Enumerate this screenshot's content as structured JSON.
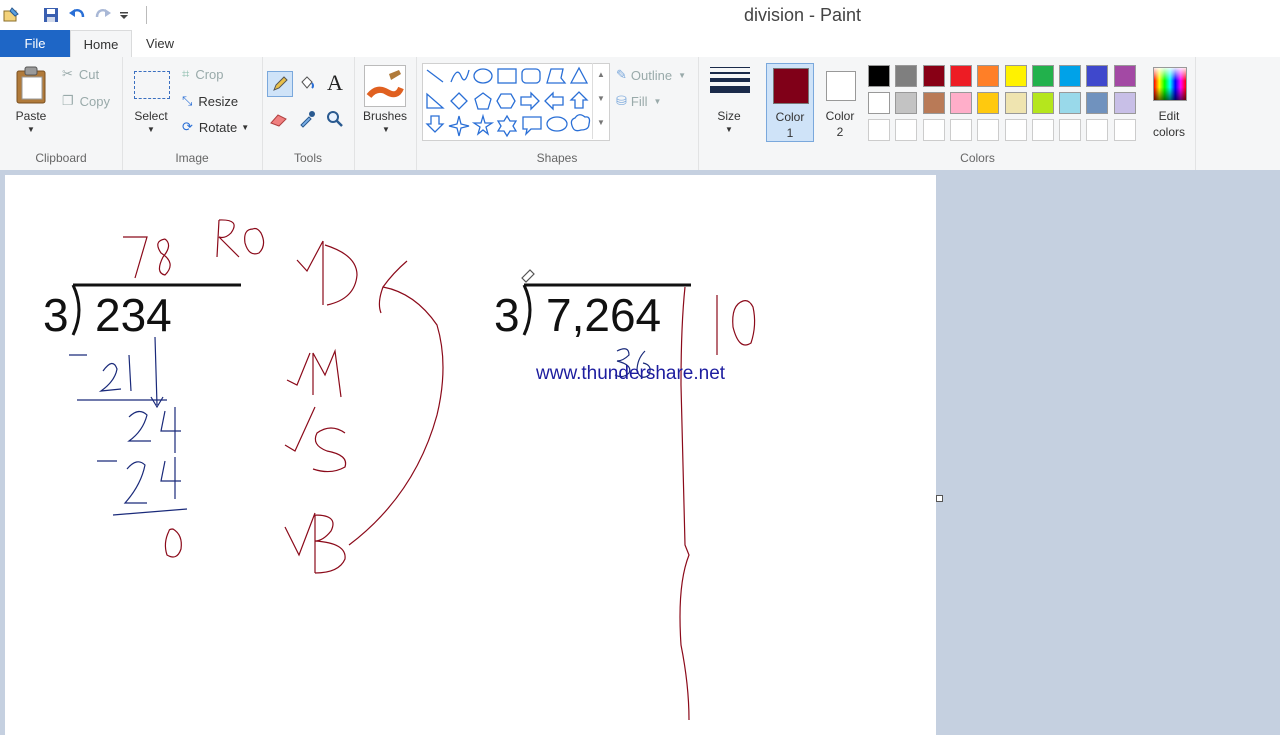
{
  "window": {
    "title": "division - Paint"
  },
  "tabs": {
    "file": "File",
    "home": "Home",
    "view": "View"
  },
  "clipboard": {
    "paste": "Paste",
    "cut": "Cut",
    "copy": "Copy",
    "group": "Clipboard"
  },
  "image": {
    "select": "Select",
    "crop": "Crop",
    "resize": "Resize",
    "rotate": "Rotate",
    "group": "Image"
  },
  "tools": {
    "group": "Tools"
  },
  "brushes": {
    "label": "Brushes"
  },
  "shapes": {
    "outline": "Outline",
    "fill": "Fill",
    "group": "Shapes"
  },
  "size": {
    "label": "Size"
  },
  "colors": {
    "color1_label_line1": "Color",
    "color1_label_line2": "1",
    "color2_label_line1": "Color",
    "color2_label_line2": "2",
    "color1": "#800018",
    "color2": "#ffffff",
    "edit_line1": "Edit",
    "edit_line2": "colors",
    "group": "Colors",
    "palette_row1": [
      "#000000",
      "#7f7f7f",
      "#880015",
      "#ed1c24",
      "#ff7f27",
      "#fff200",
      "#22b14c",
      "#00a2e8",
      "#3f48cc",
      "#a349a4"
    ],
    "palette_row2": [
      "#ffffff",
      "#c3c3c3",
      "#b97a57",
      "#ffaec9",
      "#ffc90e",
      "#efe4b0",
      "#b5e61d",
      "#99d9ea",
      "#7092be",
      "#c8bfe7"
    ]
  },
  "canvas": {
    "problem1": {
      "divisor": "3",
      "dividend": "234"
    },
    "problem2": {
      "divisor": "3",
      "dividend": "7,264"
    },
    "watermark": "www.thundershare.net"
  }
}
